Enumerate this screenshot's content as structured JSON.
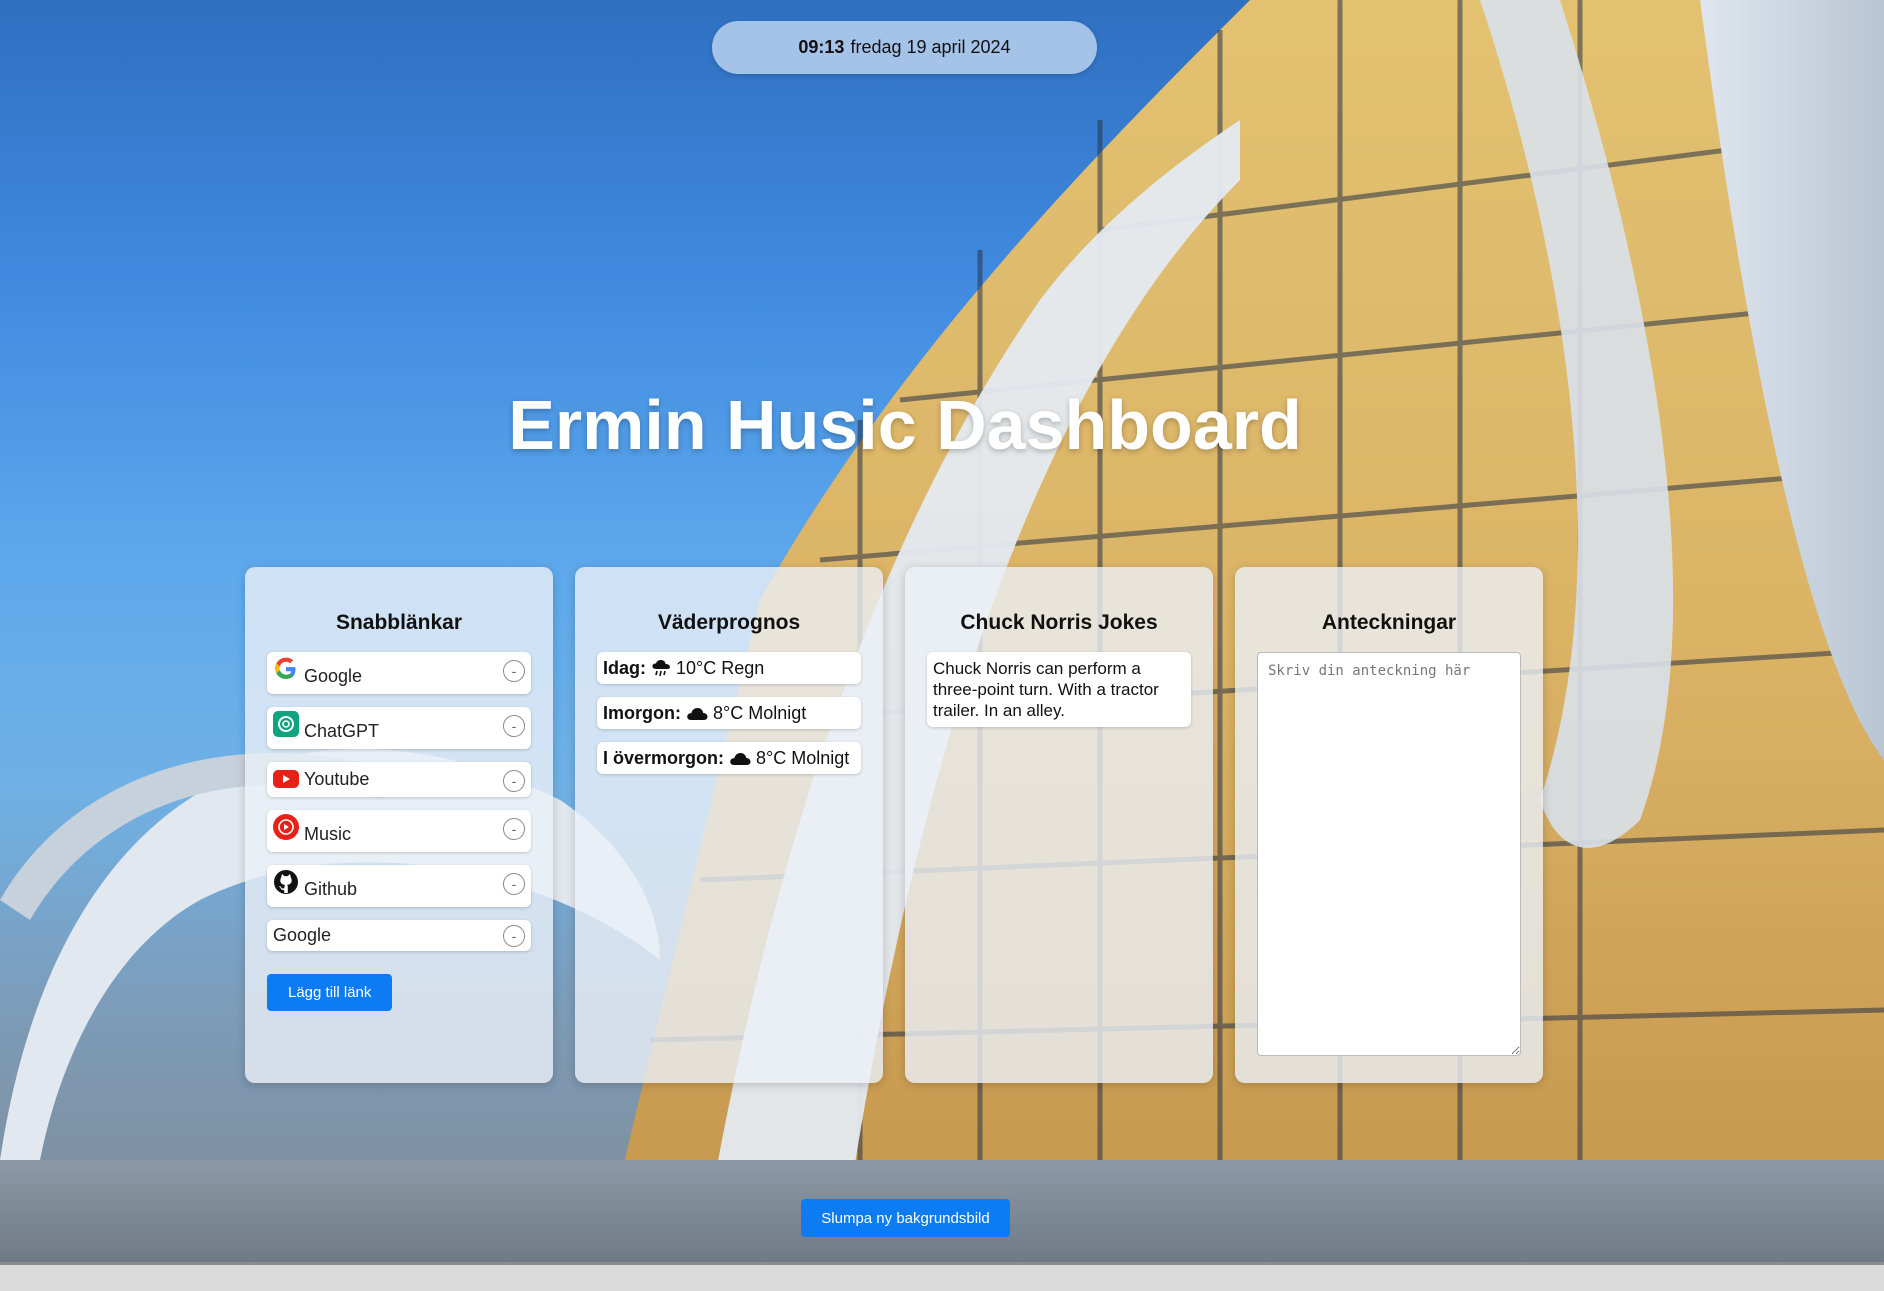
{
  "clock": {
    "time": "09:13",
    "date": "fredag 19 april 2024"
  },
  "title": "Ermin Husic Dashboard",
  "links": {
    "heading": "Snabblänkar",
    "items": [
      {
        "label": "Google",
        "icon": "google-icon",
        "remove": "-"
      },
      {
        "label": "ChatGPT",
        "icon": "chatgpt-icon",
        "remove": "-"
      },
      {
        "label": "Youtube",
        "icon": "youtube-icon",
        "remove": "-"
      },
      {
        "label": "Music",
        "icon": "youtube-music-icon",
        "remove": "-"
      },
      {
        "label": "Github",
        "icon": "github-icon",
        "remove": "-"
      },
      {
        "label": "Google",
        "icon": "",
        "remove": "-"
      }
    ],
    "add_label": "Lägg till länk"
  },
  "weather": {
    "heading": "Väderprognos",
    "days": [
      {
        "day": "Idag:",
        "icon": "cloud-rain-icon",
        "temp": "10°C",
        "desc": "Regn"
      },
      {
        "day": "Imorgon:",
        "icon": "cloud-icon",
        "temp": "8°C",
        "desc": "Molnigt"
      },
      {
        "day": "I övermorgon:",
        "icon": "cloud-icon",
        "temp": "8°C",
        "desc": "Molnigt"
      }
    ]
  },
  "jokes": {
    "heading": "Chuck Norris Jokes",
    "text": "Chuck Norris can perform a three-point turn. With a tractor trailer. In an alley."
  },
  "notes": {
    "heading": "Anteckningar",
    "placeholder": "Skriv din anteckning här"
  },
  "shuffle_label": "Slumpa ny bakgrundsbild",
  "colors": {
    "accent": "#0d7bf2",
    "card_bg": "#ebf0f8",
    "title_text": "#ffffff"
  }
}
